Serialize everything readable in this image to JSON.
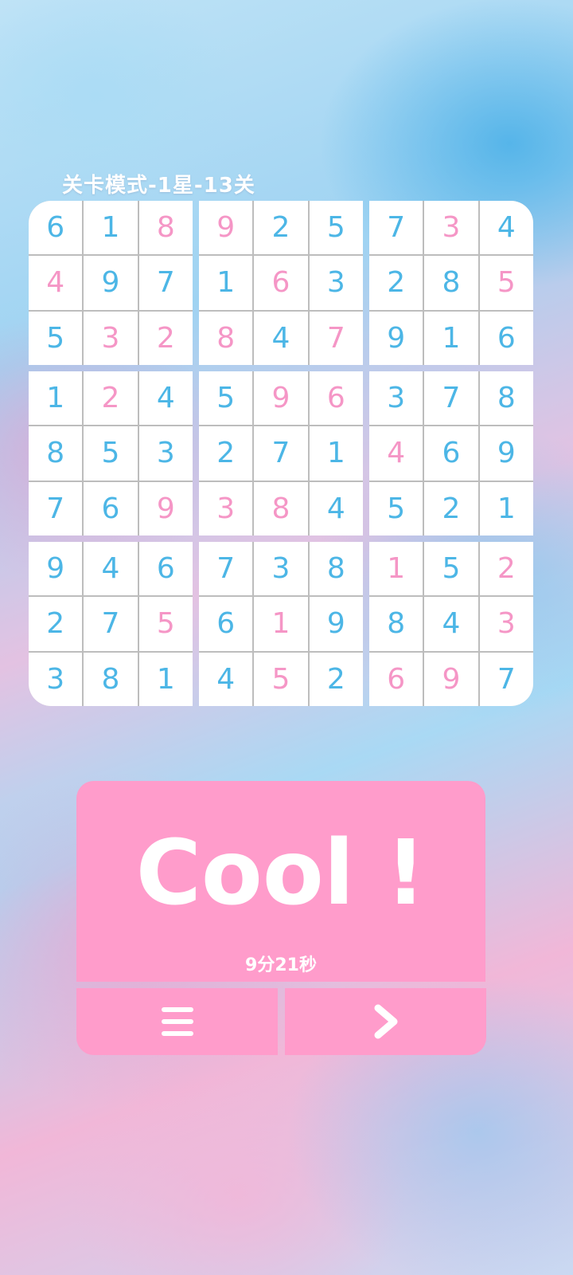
{
  "header": {
    "level_title": "关卡模式-1星-13关"
  },
  "colors": {
    "given": "#4cb6e6",
    "user": "#f596c6",
    "panel": "#ff9ccb"
  },
  "board": {
    "values": [
      [
        "6",
        "1",
        "8",
        "9",
        "2",
        "5",
        "7",
        "3",
        "4"
      ],
      [
        "4",
        "9",
        "7",
        "1",
        "6",
        "3",
        "2",
        "8",
        "5"
      ],
      [
        "5",
        "3",
        "2",
        "8",
        "4",
        "7",
        "9",
        "1",
        "6"
      ],
      [
        "1",
        "2",
        "4",
        "5",
        "9",
        "6",
        "3",
        "7",
        "8"
      ],
      [
        "8",
        "5",
        "3",
        "2",
        "7",
        "1",
        "4",
        "6",
        "9"
      ],
      [
        "7",
        "6",
        "9",
        "3",
        "8",
        "4",
        "5",
        "2",
        "1"
      ],
      [
        "9",
        "4",
        "6",
        "7",
        "3",
        "8",
        "1",
        "5",
        "2"
      ],
      [
        "2",
        "7",
        "5",
        "6",
        "1",
        "9",
        "8",
        "4",
        "3"
      ],
      [
        "3",
        "8",
        "1",
        "4",
        "5",
        "2",
        "6",
        "9",
        "7"
      ]
    ],
    "kinds": [
      [
        "g",
        "g",
        "u",
        "u",
        "g",
        "g",
        "g",
        "u",
        "g"
      ],
      [
        "u",
        "g",
        "g",
        "g",
        "u",
        "g",
        "g",
        "g",
        "u"
      ],
      [
        "g",
        "u",
        "u",
        "u",
        "g",
        "u",
        "g",
        "g",
        "g"
      ],
      [
        "g",
        "u",
        "g",
        "g",
        "u",
        "u",
        "g",
        "g",
        "g"
      ],
      [
        "g",
        "g",
        "g",
        "g",
        "g",
        "g",
        "u",
        "g",
        "g"
      ],
      [
        "g",
        "g",
        "u",
        "u",
        "u",
        "g",
        "g",
        "g",
        "g"
      ],
      [
        "g",
        "g",
        "g",
        "g",
        "g",
        "g",
        "u",
        "g",
        "u"
      ],
      [
        "g",
        "g",
        "u",
        "g",
        "u",
        "g",
        "g",
        "g",
        "u"
      ],
      [
        "g",
        "g",
        "g",
        "g",
        "u",
        "g",
        "u",
        "u",
        "g"
      ]
    ]
  },
  "result": {
    "headline": "Cool !",
    "time": "9分21秒"
  },
  "buttons": {
    "menu_icon": "menu-icon",
    "next_icon": "chevron-right-icon"
  }
}
